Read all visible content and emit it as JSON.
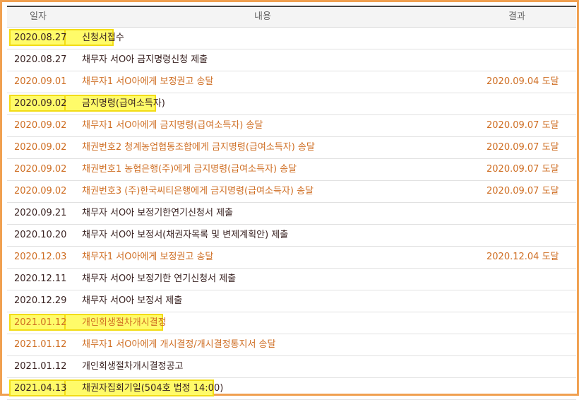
{
  "table": {
    "headers": {
      "date": "일자",
      "content": "내용",
      "result": "결과"
    },
    "rows": [
      {
        "date": "2020.08.27",
        "content": "신청서접수",
        "result": "",
        "tone": "dark",
        "highlight": true,
        "hlw": 70
      },
      {
        "date": "2020.08.27",
        "content": "채무자 서O아 금지명령신청 제출",
        "result": "",
        "tone": "dark",
        "highlight": false
      },
      {
        "date": "2020.09.01",
        "content": "채무자1 서O아에게 보정권고 송달",
        "result": "2020.09.04 도달",
        "tone": "orange",
        "highlight": false
      },
      {
        "date": "2020.09.02",
        "content": "금지명령(급여소득자)",
        "result": "",
        "tone": "dark",
        "highlight": true,
        "hlw": 130
      },
      {
        "date": "2020.09.02",
        "content": "채무자1 서O아에게 금지명령(급여소득자) 송달",
        "result": "2020.09.07 도달",
        "tone": "orange",
        "highlight": false
      },
      {
        "date": "2020.09.02",
        "content": "채권번호2 청계농업협동조합에게 금지명령(급여소득자) 송달",
        "result": "2020.09.07 도달",
        "tone": "orange",
        "highlight": false
      },
      {
        "date": "2020.09.02",
        "content": "채권번호1 농협은행(주)에게 금지명령(급여소득자) 송달",
        "result": "2020.09.07 도달",
        "tone": "orange",
        "highlight": false
      },
      {
        "date": "2020.09.02",
        "content": "채권번호3 (주)한국씨티은행에게 금지명령(급여소득자) 송달",
        "result": "2020.09.07 도달",
        "tone": "orange",
        "highlight": false
      },
      {
        "date": "2020.09.21",
        "content": "채무자 서O아 보정기한연기신청서 제출",
        "result": "",
        "tone": "dark",
        "highlight": false
      },
      {
        "date": "2020.10.20",
        "content": "채무자 서O아 보정서(채권자목록 및 변제계획안) 제출",
        "result": "",
        "tone": "dark",
        "highlight": false
      },
      {
        "date": "2020.12.03",
        "content": "채무자1 서O아에게 보정권고 송달",
        "result": "2020.12.04 도달",
        "tone": "orange",
        "highlight": false
      },
      {
        "date": "2020.12.11",
        "content": "채무자 서O아 보정기한 연기신청서 제출",
        "result": "",
        "tone": "dark",
        "highlight": false
      },
      {
        "date": "2020.12.29",
        "content": "채무자 서O아 보정서 제출",
        "result": "",
        "tone": "dark",
        "highlight": false
      },
      {
        "date": "2021.01.12",
        "content": "개인회생절차개시결정",
        "result": "",
        "tone": "orange",
        "highlight": true,
        "hlw": 140
      },
      {
        "date": "2021.01.12",
        "content": "채무자1 서O아에게 개시결정/개시결정통지서 송달",
        "result": "",
        "tone": "orange",
        "highlight": false
      },
      {
        "date": "2021.01.12",
        "content": "개인회생절차개시결정공고",
        "result": "",
        "tone": "dark",
        "highlight": false
      },
      {
        "date": "2021.04.13",
        "content": "채권자집회기일(504호 법정 14:00)",
        "result": "",
        "tone": "dark",
        "highlight": true,
        "hlw": 212
      }
    ]
  },
  "colors": {
    "frame_border": "#f0a050",
    "orange_text": "#cf6e23",
    "dark_text": "#3a2322",
    "highlight_fill": "#fffb69",
    "highlight_border": "#f2dc16"
  }
}
